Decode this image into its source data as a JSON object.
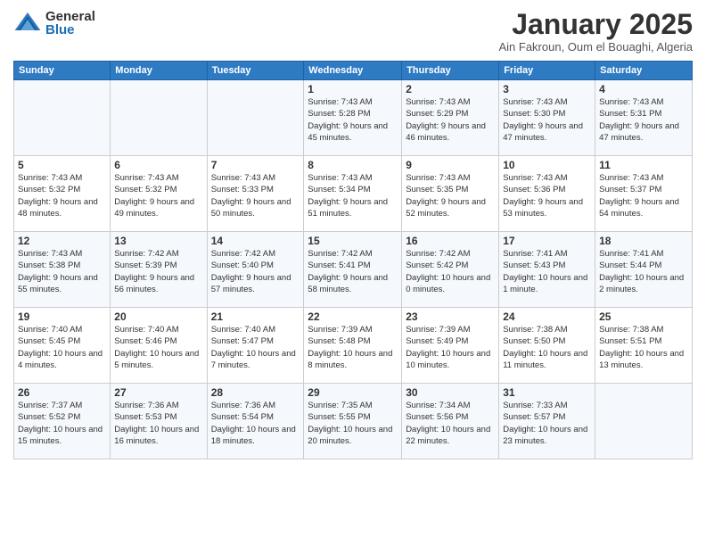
{
  "logo": {
    "general": "General",
    "blue": "Blue"
  },
  "title": "January 2025",
  "subtitle": "Ain Fakroun, Oum el Bouaghi, Algeria",
  "days_of_week": [
    "Sunday",
    "Monday",
    "Tuesday",
    "Wednesday",
    "Thursday",
    "Friday",
    "Saturday"
  ],
  "weeks": [
    [
      {
        "day": "",
        "sunrise": "",
        "sunset": "",
        "daylight": ""
      },
      {
        "day": "",
        "sunrise": "",
        "sunset": "",
        "daylight": ""
      },
      {
        "day": "",
        "sunrise": "",
        "sunset": "",
        "daylight": ""
      },
      {
        "day": "1",
        "sunrise": "Sunrise: 7:43 AM",
        "sunset": "Sunset: 5:28 PM",
        "daylight": "Daylight: 9 hours and 45 minutes."
      },
      {
        "day": "2",
        "sunrise": "Sunrise: 7:43 AM",
        "sunset": "Sunset: 5:29 PM",
        "daylight": "Daylight: 9 hours and 46 minutes."
      },
      {
        "day": "3",
        "sunrise": "Sunrise: 7:43 AM",
        "sunset": "Sunset: 5:30 PM",
        "daylight": "Daylight: 9 hours and 47 minutes."
      },
      {
        "day": "4",
        "sunrise": "Sunrise: 7:43 AM",
        "sunset": "Sunset: 5:31 PM",
        "daylight": "Daylight: 9 hours and 47 minutes."
      }
    ],
    [
      {
        "day": "5",
        "sunrise": "Sunrise: 7:43 AM",
        "sunset": "Sunset: 5:32 PM",
        "daylight": "Daylight: 9 hours and 48 minutes."
      },
      {
        "day": "6",
        "sunrise": "Sunrise: 7:43 AM",
        "sunset": "Sunset: 5:32 PM",
        "daylight": "Daylight: 9 hours and 49 minutes."
      },
      {
        "day": "7",
        "sunrise": "Sunrise: 7:43 AM",
        "sunset": "Sunset: 5:33 PM",
        "daylight": "Daylight: 9 hours and 50 minutes."
      },
      {
        "day": "8",
        "sunrise": "Sunrise: 7:43 AM",
        "sunset": "Sunset: 5:34 PM",
        "daylight": "Daylight: 9 hours and 51 minutes."
      },
      {
        "day": "9",
        "sunrise": "Sunrise: 7:43 AM",
        "sunset": "Sunset: 5:35 PM",
        "daylight": "Daylight: 9 hours and 52 minutes."
      },
      {
        "day": "10",
        "sunrise": "Sunrise: 7:43 AM",
        "sunset": "Sunset: 5:36 PM",
        "daylight": "Daylight: 9 hours and 53 minutes."
      },
      {
        "day": "11",
        "sunrise": "Sunrise: 7:43 AM",
        "sunset": "Sunset: 5:37 PM",
        "daylight": "Daylight: 9 hours and 54 minutes."
      }
    ],
    [
      {
        "day": "12",
        "sunrise": "Sunrise: 7:43 AM",
        "sunset": "Sunset: 5:38 PM",
        "daylight": "Daylight: 9 hours and 55 minutes."
      },
      {
        "day": "13",
        "sunrise": "Sunrise: 7:42 AM",
        "sunset": "Sunset: 5:39 PM",
        "daylight": "Daylight: 9 hours and 56 minutes."
      },
      {
        "day": "14",
        "sunrise": "Sunrise: 7:42 AM",
        "sunset": "Sunset: 5:40 PM",
        "daylight": "Daylight: 9 hours and 57 minutes."
      },
      {
        "day": "15",
        "sunrise": "Sunrise: 7:42 AM",
        "sunset": "Sunset: 5:41 PM",
        "daylight": "Daylight: 9 hours and 58 minutes."
      },
      {
        "day": "16",
        "sunrise": "Sunrise: 7:42 AM",
        "sunset": "Sunset: 5:42 PM",
        "daylight": "Daylight: 10 hours and 0 minutes."
      },
      {
        "day": "17",
        "sunrise": "Sunrise: 7:41 AM",
        "sunset": "Sunset: 5:43 PM",
        "daylight": "Daylight: 10 hours and 1 minute."
      },
      {
        "day": "18",
        "sunrise": "Sunrise: 7:41 AM",
        "sunset": "Sunset: 5:44 PM",
        "daylight": "Daylight: 10 hours and 2 minutes."
      }
    ],
    [
      {
        "day": "19",
        "sunrise": "Sunrise: 7:40 AM",
        "sunset": "Sunset: 5:45 PM",
        "daylight": "Daylight: 10 hours and 4 minutes."
      },
      {
        "day": "20",
        "sunrise": "Sunrise: 7:40 AM",
        "sunset": "Sunset: 5:46 PM",
        "daylight": "Daylight: 10 hours and 5 minutes."
      },
      {
        "day": "21",
        "sunrise": "Sunrise: 7:40 AM",
        "sunset": "Sunset: 5:47 PM",
        "daylight": "Daylight: 10 hours and 7 minutes."
      },
      {
        "day": "22",
        "sunrise": "Sunrise: 7:39 AM",
        "sunset": "Sunset: 5:48 PM",
        "daylight": "Daylight: 10 hours and 8 minutes."
      },
      {
        "day": "23",
        "sunrise": "Sunrise: 7:39 AM",
        "sunset": "Sunset: 5:49 PM",
        "daylight": "Daylight: 10 hours and 10 minutes."
      },
      {
        "day": "24",
        "sunrise": "Sunrise: 7:38 AM",
        "sunset": "Sunset: 5:50 PM",
        "daylight": "Daylight: 10 hours and 11 minutes."
      },
      {
        "day": "25",
        "sunrise": "Sunrise: 7:38 AM",
        "sunset": "Sunset: 5:51 PM",
        "daylight": "Daylight: 10 hours and 13 minutes."
      }
    ],
    [
      {
        "day": "26",
        "sunrise": "Sunrise: 7:37 AM",
        "sunset": "Sunset: 5:52 PM",
        "daylight": "Daylight: 10 hours and 15 minutes."
      },
      {
        "day": "27",
        "sunrise": "Sunrise: 7:36 AM",
        "sunset": "Sunset: 5:53 PM",
        "daylight": "Daylight: 10 hours and 16 minutes."
      },
      {
        "day": "28",
        "sunrise": "Sunrise: 7:36 AM",
        "sunset": "Sunset: 5:54 PM",
        "daylight": "Daylight: 10 hours and 18 minutes."
      },
      {
        "day": "29",
        "sunrise": "Sunrise: 7:35 AM",
        "sunset": "Sunset: 5:55 PM",
        "daylight": "Daylight: 10 hours and 20 minutes."
      },
      {
        "day": "30",
        "sunrise": "Sunrise: 7:34 AM",
        "sunset": "Sunset: 5:56 PM",
        "daylight": "Daylight: 10 hours and 22 minutes."
      },
      {
        "day": "31",
        "sunrise": "Sunrise: 7:33 AM",
        "sunset": "Sunset: 5:57 PM",
        "daylight": "Daylight: 10 hours and 23 minutes."
      },
      {
        "day": "",
        "sunrise": "",
        "sunset": "",
        "daylight": ""
      }
    ]
  ]
}
